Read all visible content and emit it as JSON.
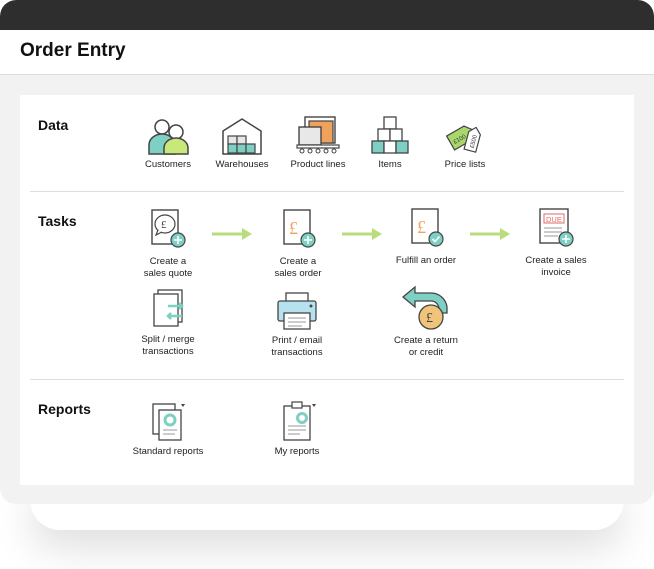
{
  "page": {
    "title": "Order Entry"
  },
  "colors": {
    "green": "#8fd14f",
    "teal": "#7fd0c4",
    "orange": "#f0a15b",
    "gray": "#444444"
  },
  "sections": {
    "data": {
      "title": "Data",
      "items": [
        {
          "label": "Customers",
          "icon": "customers-icon"
        },
        {
          "label": "Warehouses",
          "icon": "warehouse-icon"
        },
        {
          "label": "Product lines",
          "icon": "product-lines-icon"
        },
        {
          "label": "Items",
          "icon": "items-icon"
        },
        {
          "label": "Price lists",
          "icon": "price-tags-icon",
          "tag_texts": [
            "£100",
            "£500"
          ]
        }
      ]
    },
    "tasks": {
      "title": "Tasks",
      "items": [
        {
          "label": "Create a\nsales quote",
          "icon": "sales-quote-icon"
        },
        {
          "label": "Create a\nsales order",
          "icon": "sales-order-icon"
        },
        {
          "label": "Fulfill an order",
          "icon": "fulfill-order-icon"
        },
        {
          "label": "Create a sales\ninvoice",
          "icon": "sales-invoice-icon",
          "stamp": "DUE"
        },
        {
          "label": "Split / merge\ntransactions",
          "icon": "split-merge-icon"
        },
        {
          "label": "Print / email\ntransactions",
          "icon": "printer-icon"
        },
        {
          "label": "Create a return\nor credit",
          "icon": "return-credit-icon"
        }
      ]
    },
    "reports": {
      "title": "Reports",
      "items": [
        {
          "label": "Standard reports",
          "icon": "standard-reports-icon"
        },
        {
          "label": "My reports",
          "icon": "my-reports-icon"
        }
      ]
    }
  }
}
